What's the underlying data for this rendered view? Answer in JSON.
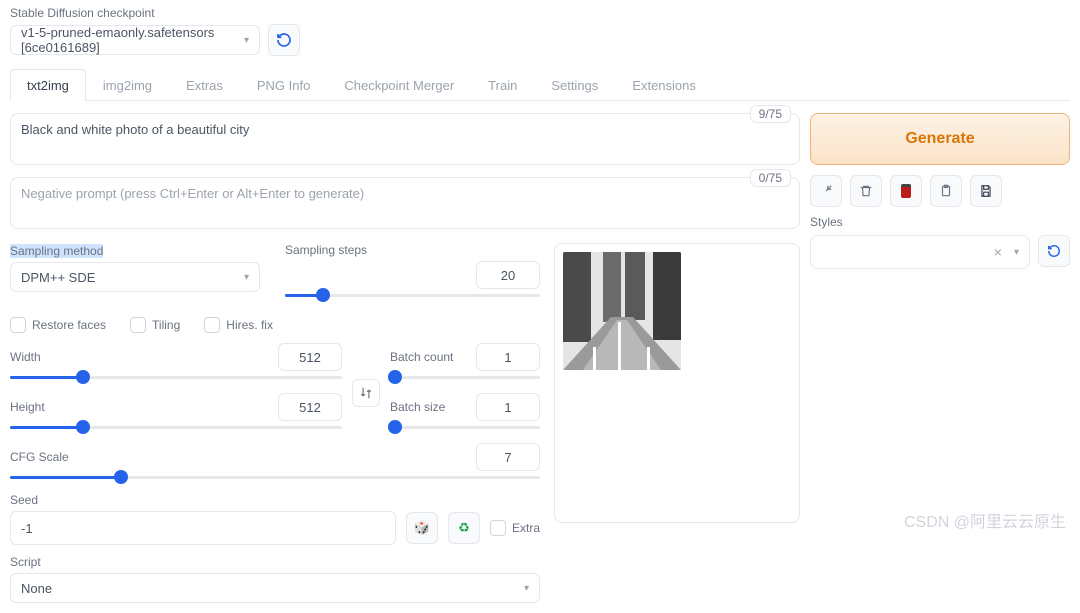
{
  "checkpoint": {
    "label": "Stable Diffusion checkpoint",
    "value": "v1-5-pruned-emaonly.safetensors [6ce0161689]"
  },
  "tabs": [
    "txt2img",
    "img2img",
    "Extras",
    "PNG Info",
    "Checkpoint Merger",
    "Train",
    "Settings",
    "Extensions"
  ],
  "active_tab": "txt2img",
  "prompt": {
    "text": "Black and white photo of a beautiful city",
    "counter": "9/75"
  },
  "neg_prompt": {
    "placeholder": "Negative prompt (press Ctrl+Enter or Alt+Enter to generate)",
    "counter": "0/75"
  },
  "generate_label": "Generate",
  "styles_label": "Styles",
  "sampling": {
    "method_label": "Sampling method",
    "method_value": "DPM++ SDE",
    "steps_label": "Sampling steps",
    "steps": "20"
  },
  "checks": {
    "restore": "Restore faces",
    "tiling": "Tiling",
    "hires": "Hires. fix"
  },
  "dims": {
    "width_label": "Width",
    "width": "512",
    "height_label": "Height",
    "height": "512"
  },
  "batch": {
    "count_label": "Batch count",
    "count": "1",
    "size_label": "Batch size",
    "size": "1"
  },
  "cfg": {
    "label": "CFG Scale",
    "value": "7"
  },
  "seed": {
    "label": "Seed",
    "value": "-1",
    "extra": "Extra"
  },
  "script": {
    "label": "Script",
    "value": "None"
  },
  "watermark": "CSDN @阿里云云原生"
}
